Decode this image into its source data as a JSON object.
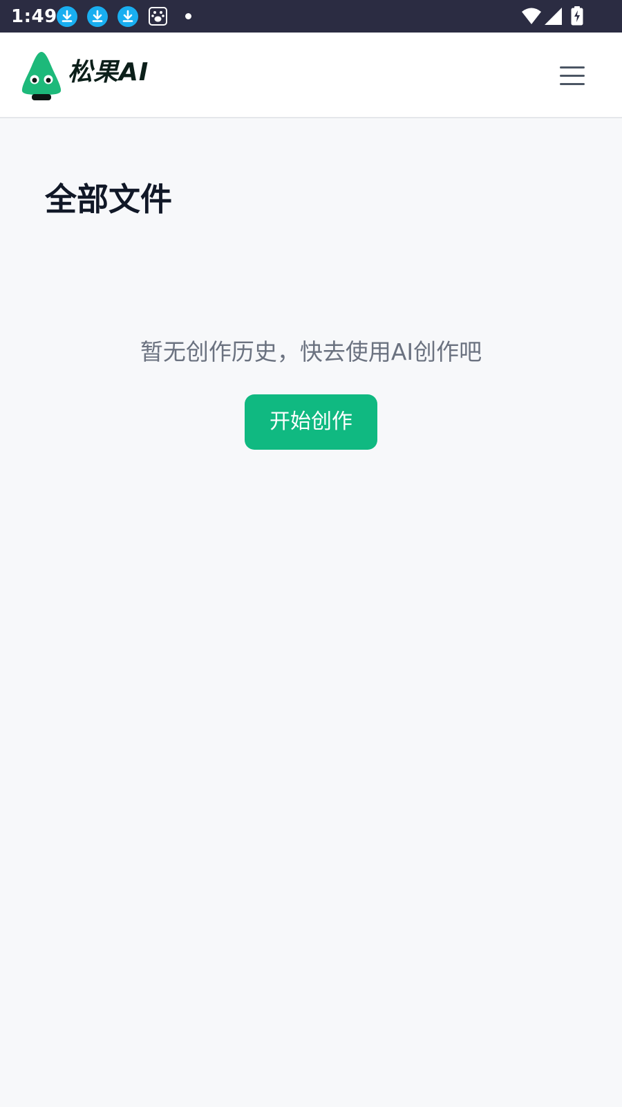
{
  "status_bar": {
    "time": "1:49",
    "background": "#2b2c42",
    "notification_icons": [
      "download-icon",
      "download-icon",
      "download-icon",
      "baidu-paw-icon",
      "dot-icon"
    ],
    "system_icons": [
      "wifi-icon",
      "cell-signal-icon",
      "battery-charging-icon"
    ]
  },
  "header": {
    "brand": "松果AI",
    "logo_icon": "pinecone-mascot-icon",
    "menu_icon": "hamburger-menu-icon",
    "background": "#ffffff"
  },
  "main": {
    "title": "全部文件",
    "empty_message": "暂无创作历史，快去使用AI创作吧",
    "start_button_label": "开始创作",
    "background": "#f7f8fa"
  },
  "colors": {
    "accent": "#10b981",
    "brand_logo": "#1db97a",
    "title_text": "#111827",
    "muted_text": "#6b7280",
    "notification_blue": "#19aef0"
  }
}
